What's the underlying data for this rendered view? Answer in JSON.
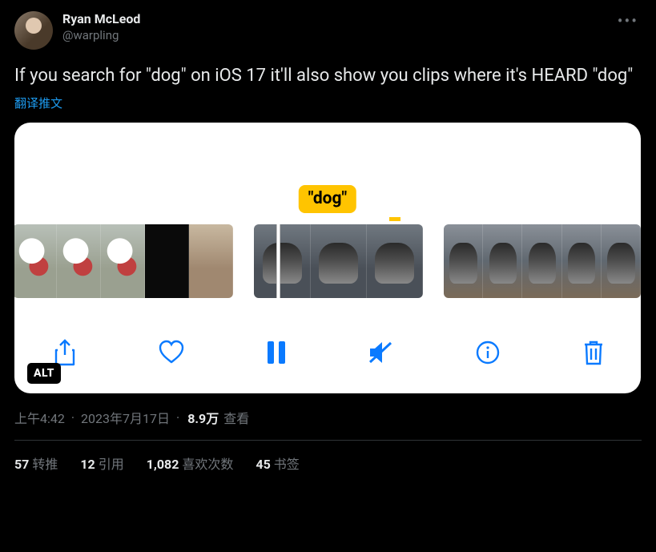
{
  "author": {
    "display_name": "Ryan McLeod",
    "handle": "@warpling"
  },
  "body": "If you search for \"dog\" on iOS 17 it'll also show you clips where it's HEARD \"dog\"",
  "translate_label": "翻译推文",
  "media": {
    "highlight_label": "\"dog\"",
    "alt_badge": "ALT"
  },
  "meta": {
    "time": "上午4:42",
    "date": "2023年7月17日",
    "views_num": "8.9万",
    "views_label": "查看"
  },
  "stats": {
    "retweets": {
      "num": "57",
      "label": "转推"
    },
    "quotes": {
      "num": "12",
      "label": "引用"
    },
    "likes": {
      "num": "1,082",
      "label": "喜欢次数"
    },
    "bookmarks": {
      "num": "45",
      "label": "书签"
    }
  }
}
